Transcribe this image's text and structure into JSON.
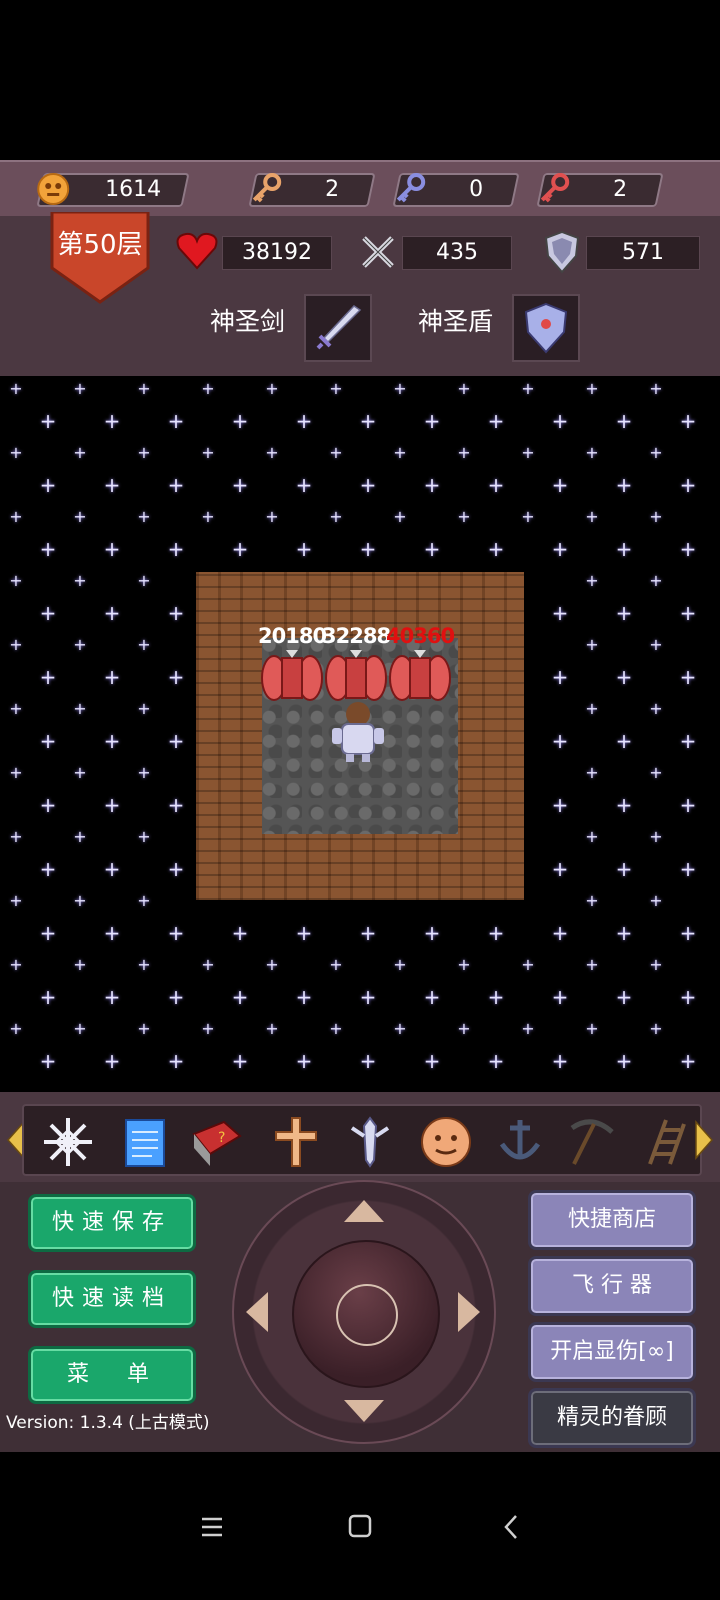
{
  "resources": {
    "coins": "1614",
    "yellow_keys": "2",
    "blue_keys": "0",
    "red_keys": "2"
  },
  "hero": {
    "floor_label": "第50层",
    "hp": "38192",
    "attack": "435",
    "defense": "571",
    "weapon_name": "神圣剑",
    "shield_name": "神圣盾"
  },
  "map": {
    "damage_1": "20180",
    "damage_2": "32288",
    "damage_3": "40360"
  },
  "buttons": {
    "quick_save": "快速保存",
    "quick_load": "快速读档",
    "menu": "菜　单",
    "quick_shop": "快捷商店",
    "flyer": "飞 行 器",
    "show_damage": "开启显伤[∞]",
    "fairy_blessing": "精灵的眷顾"
  },
  "version_text": "Version: 1.3.4 (上古模式)",
  "colors": {
    "coin": "#f2a33a",
    "yellow_key": "#e8a36a",
    "blue_key": "#8a8ee0",
    "red_key": "#e05050",
    "damage_normal": "#ffffff",
    "damage_danger": "#e01010",
    "quick_button": "#1aa76b",
    "menu_button": "#8b85b8"
  }
}
